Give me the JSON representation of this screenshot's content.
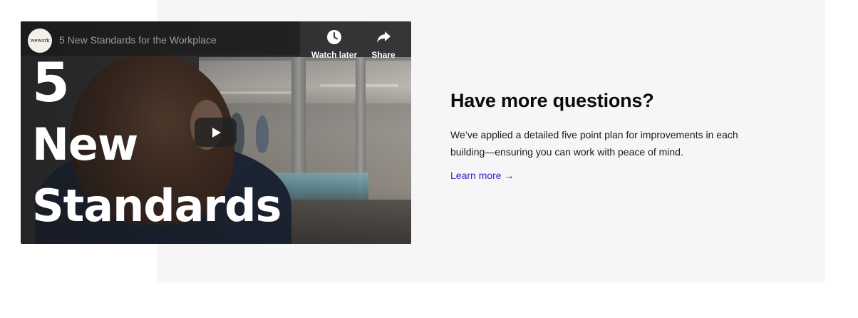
{
  "video": {
    "channel_logo_text": "wework",
    "title": "5 New Standards for the Workplace",
    "watch_later_label": "Watch later",
    "share_label": "Share",
    "overlay_lines": [
      "5",
      "New",
      "Standards"
    ]
  },
  "section": {
    "heading": "Have more questions?",
    "body": "We’ve applied a detailed five point plan for improvements in each building—ensuring you can work with peace of mind.",
    "link_label": "Learn more →",
    "link_color": "#2a1ec9",
    "panel_color": "#f6f6f6"
  }
}
